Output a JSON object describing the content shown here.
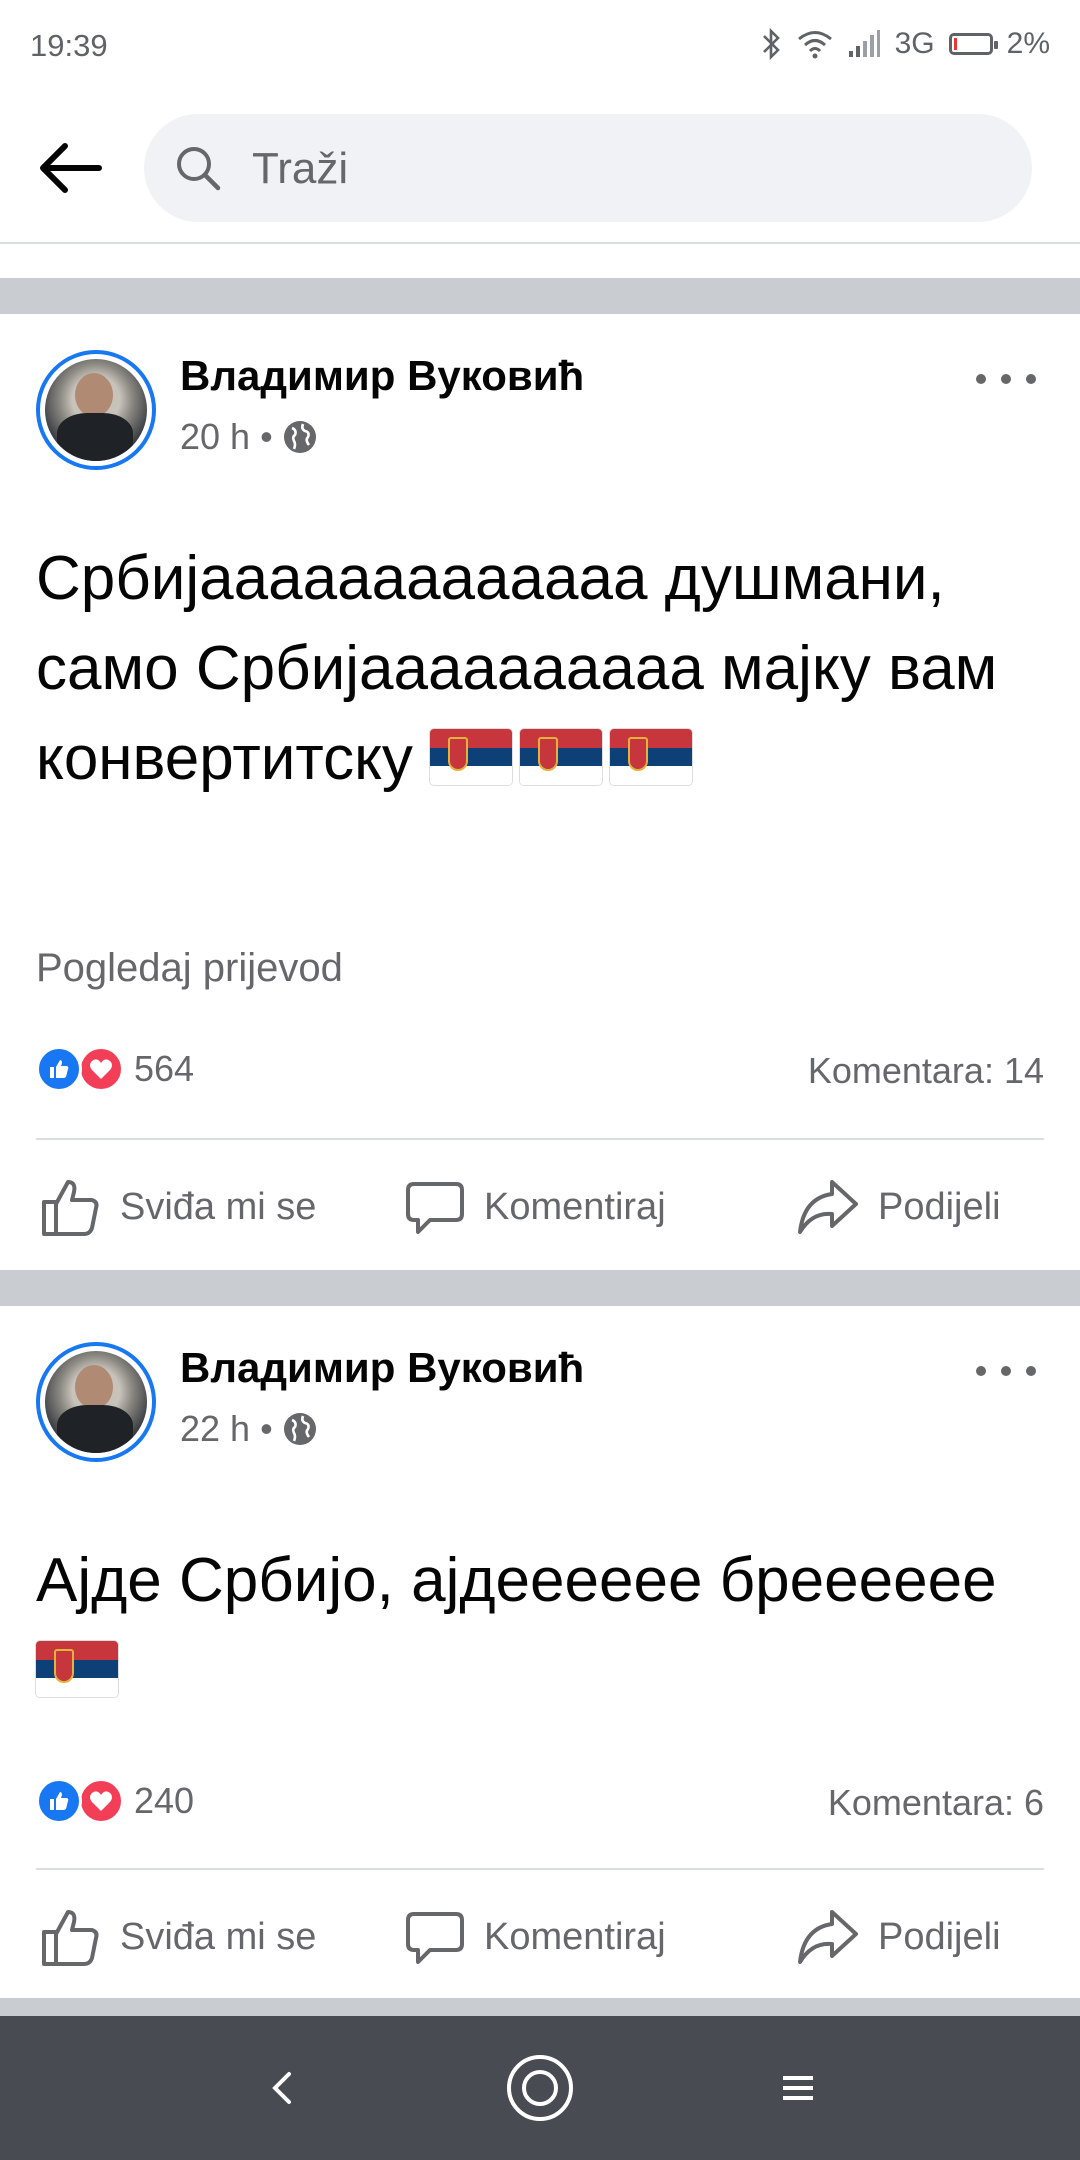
{
  "status_bar": {
    "time": "19:39",
    "network": "3G",
    "battery": "2%"
  },
  "search": {
    "placeholder": "Traži"
  },
  "posts": [
    {
      "author": "Владимир Вуковић",
      "time": "20 h",
      "text": "Србијааааааааааааа душмани, само Србијаааааааааа мајку вам конвертитску",
      "flags": 3,
      "translate_label": "Pogledaj prijevod",
      "reaction_count": "564",
      "comments_label": "Komentara: 14"
    },
    {
      "author": "Владимир Вуковић",
      "time": "22 h",
      "text": "Ајде Србијо, ајдееееее бреееееe",
      "flags": 1,
      "reaction_count": "240",
      "comments_label": "Komentara: 6"
    }
  ],
  "actions": {
    "like": "Sviđa mi se",
    "comment": "Komentiraj",
    "share": "Podijeli"
  },
  "colors": {
    "accent": "#1877f2",
    "love": "#f33e58",
    "muted": "#65676b",
    "separator": "#c9ccd1"
  },
  "icons": [
    "back-arrow-icon",
    "search-icon",
    "globe-icon",
    "more-icon",
    "like-icon",
    "comment-icon",
    "share-icon",
    "nav-back-icon",
    "nav-home-icon",
    "nav-menu-icon"
  ]
}
